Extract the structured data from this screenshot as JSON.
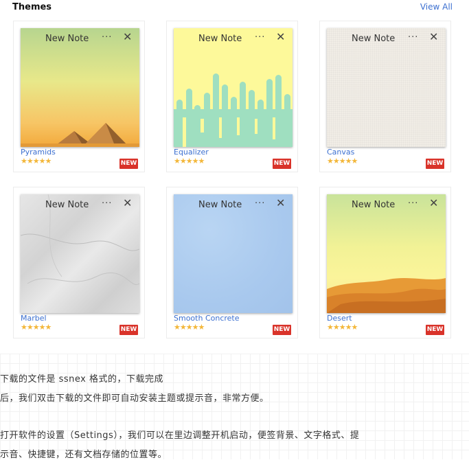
{
  "section": {
    "title": "Themes",
    "view_all": "View All"
  },
  "themes": [
    {
      "name": "Pyramids",
      "note_title": "New Note",
      "dots": "···",
      "close": "✕",
      "stars": "★★★★★",
      "badge": "NEW"
    },
    {
      "name": "Equalizer",
      "note_title": "New Note",
      "dots": "···",
      "close": "✕",
      "stars": "★★★★★",
      "badge": "NEW"
    },
    {
      "name": "Canvas",
      "note_title": "New Note",
      "dots": "···",
      "close": "✕",
      "stars": "★★★★★",
      "badge": "NEW"
    },
    {
      "name": "Marbel",
      "note_title": "New Note",
      "dots": "···",
      "close": "✕",
      "stars": "★★★★★",
      "badge": "NEW"
    },
    {
      "name": "Smooth Concrete",
      "note_title": "New Note",
      "dots": "···",
      "close": "✕",
      "stars": "★★★★★",
      "badge": "NEW"
    },
    {
      "name": "Desert",
      "note_title": "New Note",
      "dots": "···",
      "close": "✕",
      "stars": "★★★★★",
      "badge": "NEW"
    }
  ],
  "article": {
    "line1": "下载的文件是 ssnex 格式的，下载完成",
    "line2": "后，我们双击下载的文件即可自动安装主题或提示音，非常方便。",
    "line3": "打开软件的设置（Settings），我们可以在里边调整开机启动，便签背景、文字格式、提",
    "line4": "示音、快捷键，还有文档存储的位置等。"
  },
  "colors": {
    "link": "#3b6fd0",
    "badge": "#d9332a",
    "star": "#f3b73a"
  }
}
